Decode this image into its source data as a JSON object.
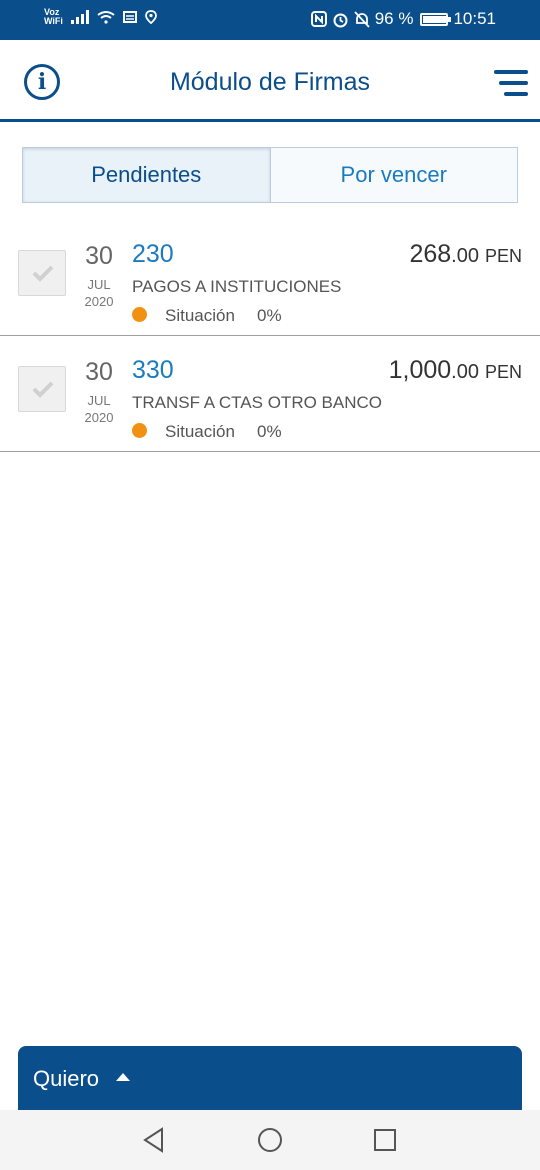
{
  "status_bar": {
    "carrier_line1": "Voz",
    "carrier_line2": "WiFi",
    "battery": "96 %",
    "time": "10:51"
  },
  "header": {
    "title": "Módulo de Firmas",
    "info_icon": "info-icon",
    "menu_icon": "hamburger-menu-icon"
  },
  "tabs": [
    {
      "label": "Pendientes",
      "active": true
    },
    {
      "label": "Por vencer",
      "active": false
    }
  ],
  "items": [
    {
      "day": "30",
      "month": "JUL",
      "year": "2020",
      "number": "230",
      "description": "PAGOS A INSTITUCIONES",
      "amount_int": "268",
      "amount_dec": ".00",
      "currency": "PEN",
      "status_label": "Situación",
      "status_value": "0%"
    },
    {
      "day": "30",
      "month": "JUL",
      "year": "2020",
      "number": "330",
      "description": "TRANSF A CTAS OTRO BANCO",
      "amount_int": "1,000",
      "amount_dec": ".00",
      "currency": "PEN",
      "status_label": "Situación",
      "status_value": "0%"
    }
  ],
  "bottom_panel": {
    "label": "Quiero"
  },
  "colors": {
    "primary": "#0a4e8c",
    "link": "#1b7bbf",
    "status_dot": "#f29111"
  }
}
